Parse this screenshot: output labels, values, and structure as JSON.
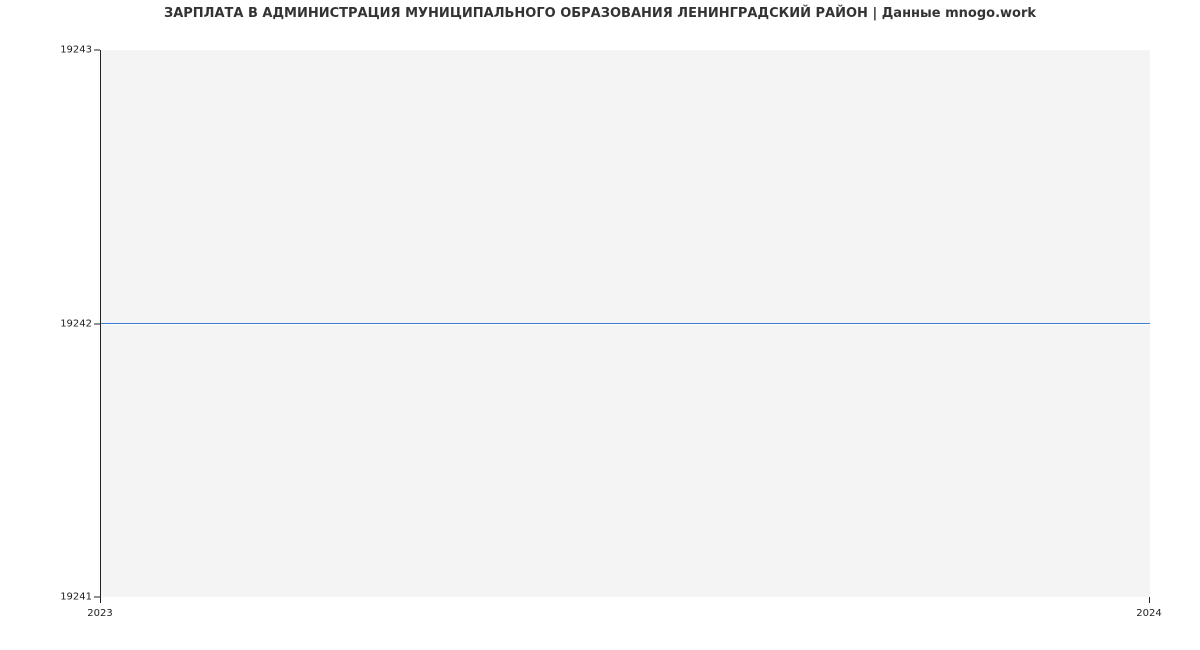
{
  "chart_data": {
    "type": "line",
    "title": "ЗАРПЛАТА В АДМИНИСТРАЦИЯ МУНИЦИПАЛЬНОГО ОБРАЗОВАНИЯ ЛЕНИНГРАДСКИЙ РАЙОН | Данные mnogo.work",
    "x": [
      2023,
      2024
    ],
    "values": [
      19242,
      19242
    ],
    "xticks": [
      2023,
      2024
    ],
    "yticks": [
      19241,
      19242,
      19243
    ],
    "xlim": [
      2023,
      2024
    ],
    "ylim": [
      19241,
      19243
    ],
    "xlabel": "",
    "ylabel": ""
  }
}
